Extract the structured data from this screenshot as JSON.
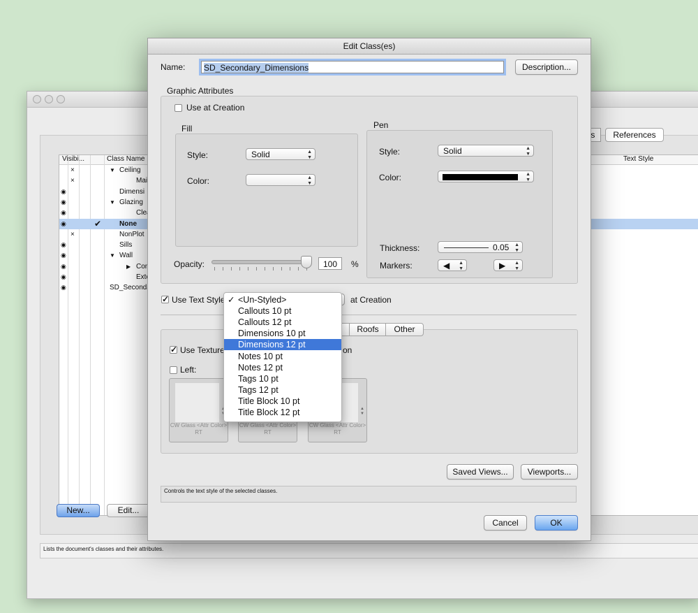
{
  "background_window": {
    "tabs": [
      "ws",
      "References"
    ],
    "list_headers": {
      "visibility": "Visibi...",
      "class_name": "Class Name",
      "text_style": "Text Style"
    },
    "rows": [
      {
        "vis": "×",
        "name": "Ceiling",
        "toggle": "▼",
        "sel": false
      },
      {
        "vis": "×",
        "name": "Main",
        "toggle": "",
        "sel": false
      },
      {
        "vis": "eye",
        "name": "Dimensi",
        "toggle": "",
        "sel": false
      },
      {
        "vis": "eye",
        "name": "Glazing",
        "toggle": "▼",
        "sel": false
      },
      {
        "vis": "eye",
        "name": "Clear",
        "toggle": "",
        "sel": false
      },
      {
        "vis": "eye",
        "name": "None",
        "toggle": "",
        "sel": true
      },
      {
        "vis": "×",
        "name": "NonPlot",
        "toggle": "",
        "sel": false
      },
      {
        "vis": "eye",
        "name": "Sills",
        "toggle": "",
        "sel": false
      },
      {
        "vis": "eye",
        "name": "Wall",
        "toggle": "▼",
        "sel": false
      },
      {
        "vis": "eye",
        "name": "Compo",
        "toggle": "▶",
        "sel": false
      },
      {
        "vis": "eye",
        "name": "Exterio",
        "toggle": "",
        "sel": false
      },
      {
        "vis": "eye",
        "name": "SD_Secondar",
        "toggle": "",
        "sel": false
      }
    ],
    "new_button": "New...",
    "edit_button": "Edit...",
    "status_text": "Lists the document's classes and their attributes."
  },
  "dialog": {
    "title": "Edit Class(es)",
    "name_label": "Name:",
    "name_value": "SD_Secondary_Dimensions",
    "description_button": "Description...",
    "graphic_attributes_label": "Graphic Attributes",
    "use_at_creation_label": "Use at Creation",
    "use_at_creation_checked": false,
    "fill": {
      "label": "Fill",
      "style_label": "Style:",
      "style_value": "Solid",
      "color_label": "Color:"
    },
    "pen": {
      "label": "Pen",
      "style_label": "Style:",
      "style_value": "Solid",
      "color_label": "Color:",
      "color_value": "#000000",
      "thickness_label": "Thickness:",
      "thickness_value": "0.05",
      "markers_label": "Markers:",
      "marker_left": "◀",
      "marker_right": "▶"
    },
    "opacity_label": "Opacity:",
    "opacity_value": "100",
    "opacity_unit": "%",
    "use_text_style_label": "Use Text Style",
    "use_text_style_checked": true,
    "at_creation_label": "at Creation",
    "tabs": [
      "Roofs",
      "Other"
    ],
    "use_textures_label": "Use Texture",
    "use_textures_suffix": "on",
    "left_label": "Left:",
    "texture_tiles": [
      {
        "caption": "CW Glass <Attr Color> RT"
      },
      {
        "caption": "CW Glass <Attr Color> RT"
      },
      {
        "caption": "CW Glass <Attr Color> RT"
      }
    ],
    "saved_views_button": "Saved Views...",
    "viewports_button": "Viewports...",
    "status_text": "Controls the text style of the selected classes.",
    "cancel_button": "Cancel",
    "ok_button": "OK"
  },
  "text_style_menu": {
    "items": [
      {
        "label": "<Un-Styled>",
        "checked": true,
        "selected": false
      },
      {
        "label": "Callouts 10 pt",
        "checked": false,
        "selected": false
      },
      {
        "label": "Callouts 12 pt",
        "checked": false,
        "selected": false
      },
      {
        "label": "Dimensions 10 pt",
        "checked": false,
        "selected": false
      },
      {
        "label": "Dimensions 12 pt",
        "checked": false,
        "selected": true
      },
      {
        "label": "Notes 10 pt",
        "checked": false,
        "selected": false
      },
      {
        "label": "Notes 12 pt",
        "checked": false,
        "selected": false
      },
      {
        "label": "Tags 10 pt",
        "checked": false,
        "selected": false
      },
      {
        "label": "Tags 12 pt",
        "checked": false,
        "selected": false
      },
      {
        "label": "Title Block 10 pt",
        "checked": false,
        "selected": false
      },
      {
        "label": "Title Block 12 pt",
        "checked": false,
        "selected": false
      }
    ]
  }
}
